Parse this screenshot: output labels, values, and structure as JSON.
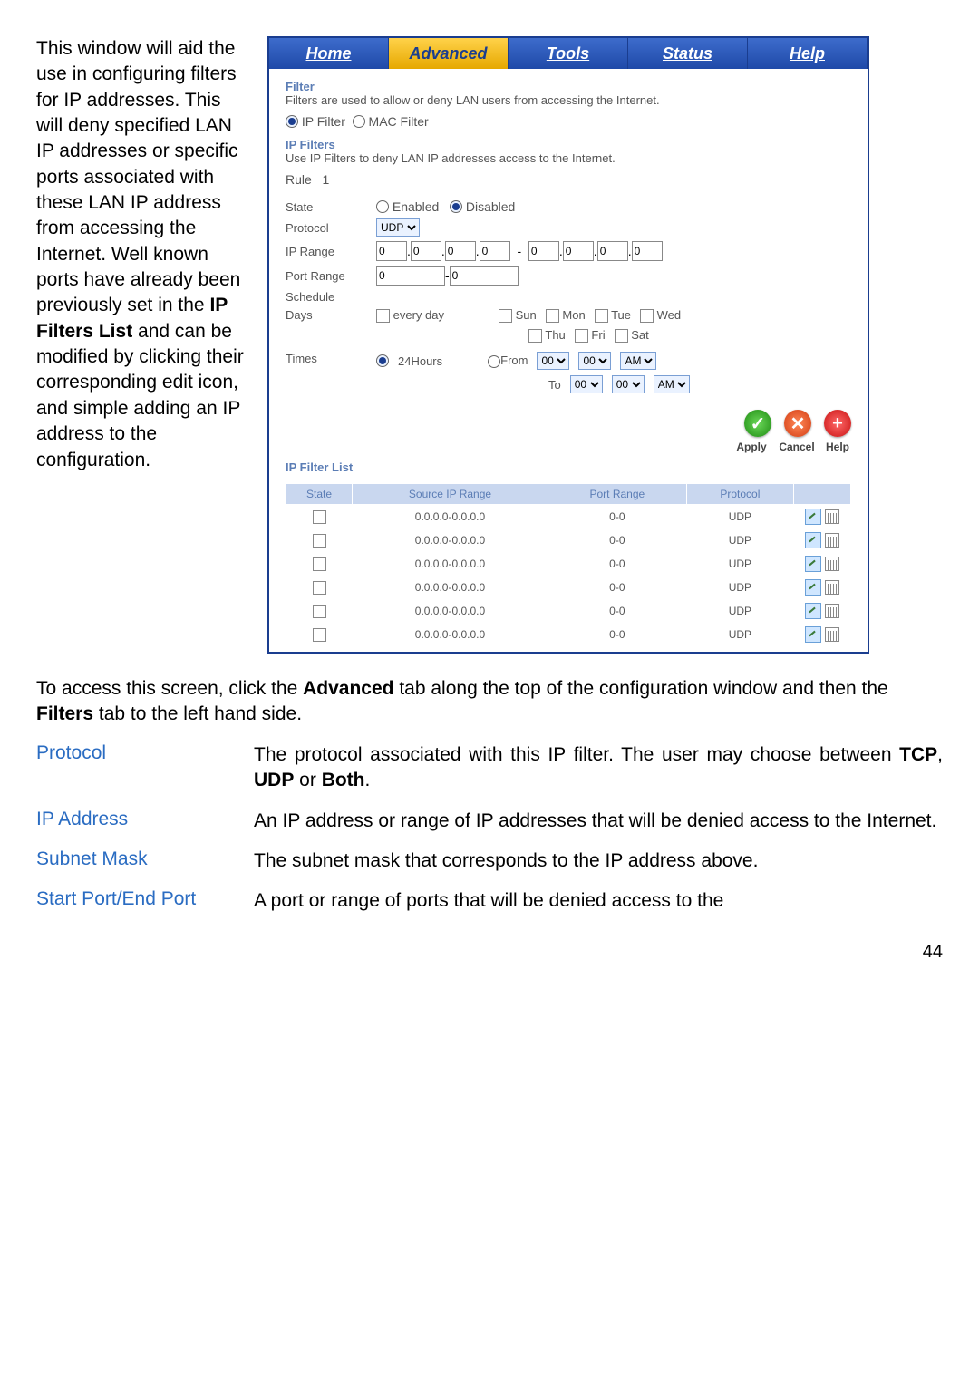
{
  "leftPara_a": "This window will aid the use in configuring filters for IP addresses. This will deny specified LAN IP addresses or specific ports associated with these LAN IP address from accessing the Internet. Well known ports have already been previously set in the ",
  "leftPara_bold": "IP Filters List",
  "leftPara_b": " and can be modified by clicking their corresponding edit icon, and simple adding an IP address to the configuration.",
  "tabs": {
    "home": "Home",
    "advanced": "Advanced",
    "tools": "Tools",
    "status": "Status",
    "help": "Help"
  },
  "filter": {
    "title": "Filter",
    "desc": "Filters are used to allow or deny LAN users from accessing the Internet.",
    "ipfilter": "IP Filter",
    "macfilter": "MAC Filter"
  },
  "ipf": {
    "title": "IP Filters",
    "desc": "Use IP Filters to deny LAN IP addresses access to the Internet.",
    "rule": "Rule   1",
    "state": "State",
    "enabled": "Enabled",
    "disabled": "Disabled",
    "protocol": "Protocol",
    "protoVal": "UDP",
    "iprange": "IP Range",
    "portrange": "Port Range",
    "schedule": "Schedule",
    "days": "Days",
    "everyday": "every day",
    "sun": "Sun",
    "mon": "Mon",
    "tue": "Tue",
    "wed": "Wed",
    "thu": "Thu",
    "fri": "Fri",
    "sat": "Sat",
    "times": "Times",
    "h24": "24Hours",
    "from": "From",
    "to": "To",
    "t00": "00",
    "am": "AM",
    "ip0": "0",
    "port0": "0"
  },
  "btns": {
    "apply": "Apply",
    "cancel": "Cancel",
    "help": "Help"
  },
  "list": {
    "title": "IP Filter List",
    "hState": "State",
    "hSrc": "Source IP Range",
    "hPort": "Port Range",
    "hProto": "Protocol",
    "src": "0.0.0.0-0.0.0.0",
    "port": "0-0",
    "proto": "UDP"
  },
  "after_a": "To access this screen, click the ",
  "after_b": "Advanced",
  "after_c": " tab along the top of the configuration window and then the ",
  "after_d": "Filters",
  "after_e": " tab to the left hand side.",
  "params": {
    "protocol": {
      "label": "Protocol",
      "val_a": "The protocol associated with this IP filter. The user may choose between ",
      "tcp": "TCP",
      "comma": ", ",
      "udp": "UDP",
      "or": " or ",
      "both": "Both",
      "dot": "."
    },
    "ip": {
      "label": "IP Address",
      "val": "An IP address or range of IP addresses that will be denied access to the Internet."
    },
    "subnet": {
      "label": "Subnet Mask",
      "val": "The subnet mask that corresponds to the IP address above."
    },
    "port": {
      "label": "Start Port/End Port",
      "val": "A port or range of ports that will be denied access to the"
    }
  },
  "pagenum": "44"
}
